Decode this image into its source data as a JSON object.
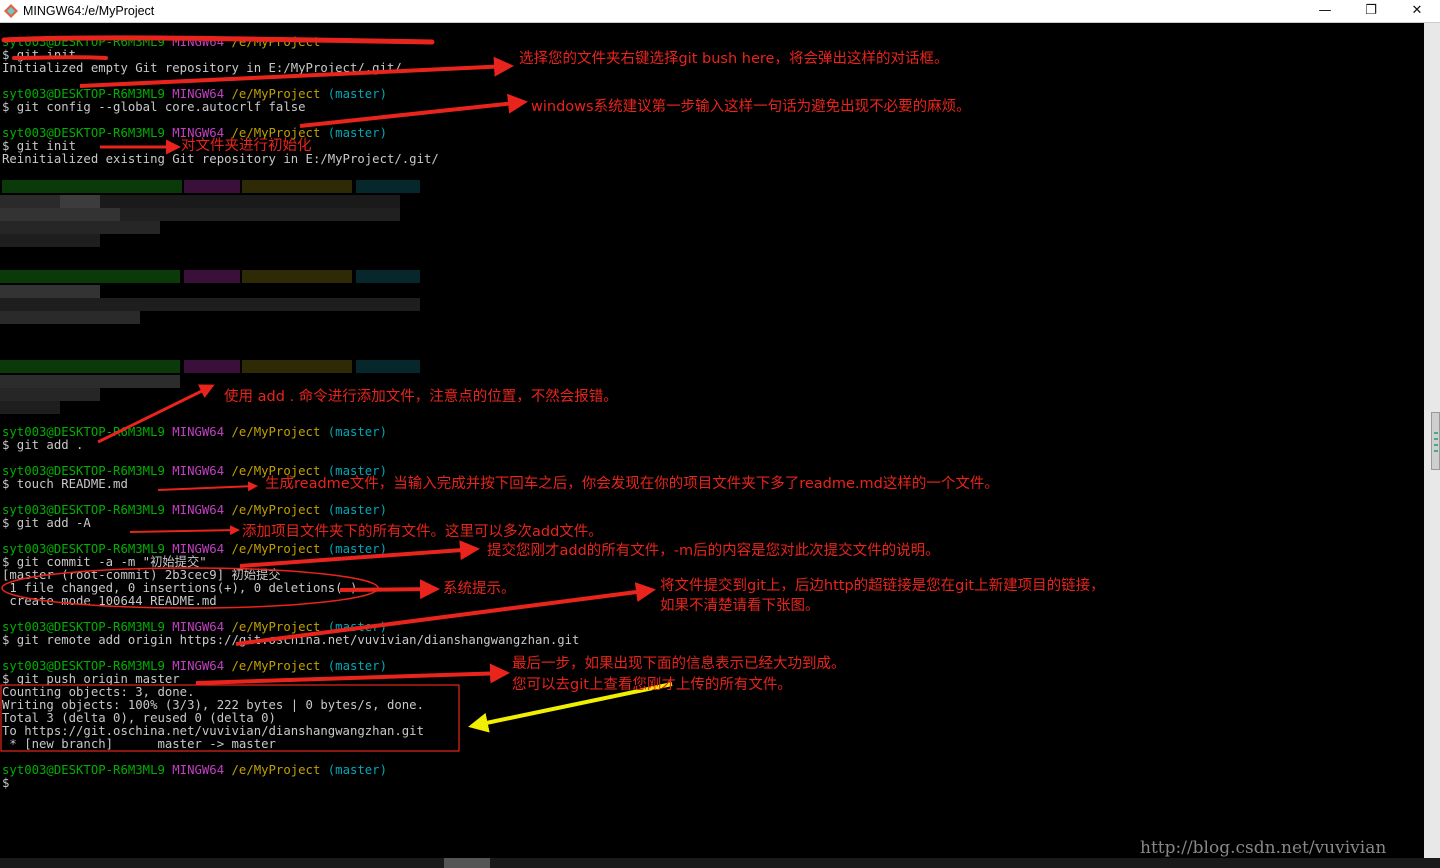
{
  "window": {
    "title": "MINGW64:/e/MyProject"
  },
  "prompt": {
    "user": "syt003@DESKTOP-R6M3ML9",
    "system": "MINGW64",
    "path": "/e/MyProject",
    "branch": "(master)"
  },
  "lines": {
    "cmd_init1": "$ git init",
    "out_init1": "Initialized empty Git repository in E:/MyProject/.git/",
    "cmd_config": "$ git config --global core.autocrlf false",
    "cmd_init2": "$ git init",
    "out_init2": "Reinitialized existing Git repository in E:/MyProject/.git/",
    "cmd_add_dot": "$ git add .",
    "cmd_touch": "$ touch README.md",
    "cmd_add_A": "$ git add -A",
    "cmd_commit": "$ git commit -a -m \"初始提交\"",
    "out_commit1": "[master (root-commit) 2b3cec9] 初始提交",
    "out_commit2": " 1 file changed, 0 insertions(+), 0 deletions(-)",
    "out_commit3": " create mode 100644 README.md",
    "cmd_remote": "$ git remote add origin https://git.oschina.net/vuvivian/dianshangwangzhan.git",
    "cmd_push": "$ git push origin master",
    "out_push1": "Counting objects: 3, done.",
    "out_push2": "Writing objects: 100% (3/3), 222 bytes | 0 bytes/s, done.",
    "out_push3": "Total 3 (delta 0), reused 0 (delta 0)",
    "out_push4": "To https://git.oschina.net/vuvivian/dianshangwangzhan.git",
    "out_push5": " * [new branch]      master -> master",
    "cmd_final": "$"
  },
  "annotations": {
    "a1": "选择您的文件夹右键选择git bush here，将会弹出这样的对话框。",
    "a2": "windows系统建议第一步输入这样一句话为避免出现不必要的麻烦。",
    "a3": "对文件夹进行初始化",
    "a4": "使用 add . 命令进行添加文件，注意点的位置，不然会报错。",
    "a5": "生成readme文件，当输入完成并按下回车之后，你会发现在你的项目文件夹下多了readme.md这样的一个文件。",
    "a6": "添加项目文件夹下的所有文件。这里可以多次add文件。",
    "a7": "提交您刚才add的所有文件，-m后的内容是您对此次提交文件的说明。",
    "a8": "系统提示。",
    "a9_line1": "将文件提交到git上，后边http的超链接是您在git上新建项目的链接，",
    "a9_line2": "如果不清楚请看下张图。",
    "a10_line1": "最后一步，如果出现下面的信息表示已经大功到成。",
    "a10_line2": "您可以去git上查看您刚才上传的所有文件。"
  },
  "watermark": "http://blog.csdn.net/vuvivian",
  "colors": {
    "prompt_user": "#00b000",
    "prompt_system": "#c040c0",
    "prompt_path": "#c0a000",
    "prompt_branch": "#00a8b8",
    "annotation": "#e8241c",
    "arrow_highlight": "#f0f000"
  }
}
